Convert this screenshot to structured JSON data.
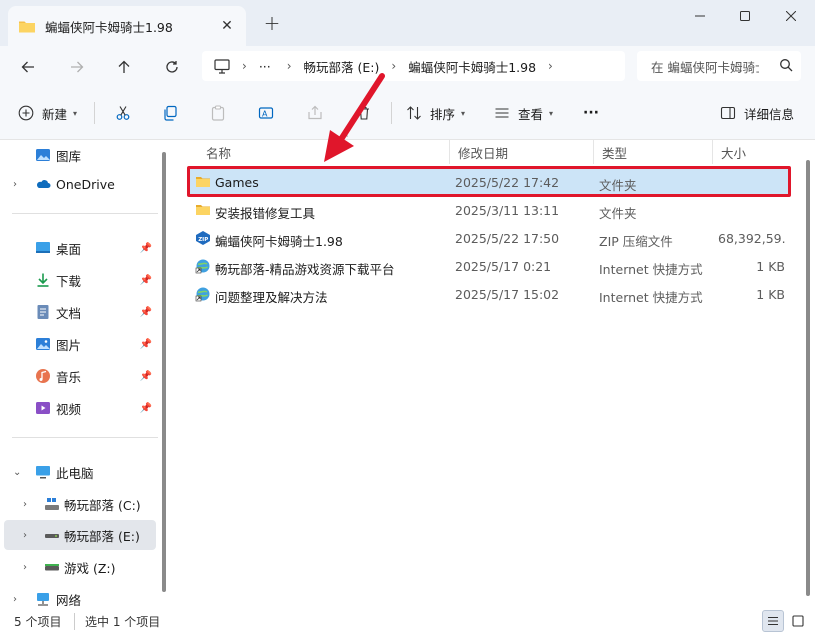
{
  "window": {
    "tab_title": "蝙蝠侠阿卡姆骑士1.98",
    "tab_close": "✕",
    "new_tab": "+"
  },
  "address": {
    "ellipsis": "···",
    "breadcrumbs": [
      "畅玩部落 (E:)",
      "蝙蝠侠阿卡姆骑士1.98"
    ],
    "search_placeholder": "在 蝙蝠侠阿卡姆骑士1.98 中搜索"
  },
  "toolbar": {
    "new_label": "新建",
    "sort_label": "排序",
    "view_label": "查看",
    "more_label": "···",
    "details_label": "详细信息"
  },
  "sidebar": {
    "items": [
      {
        "label": "图库",
        "icon": "gallery-icon"
      },
      {
        "label": "OneDrive",
        "icon": "onedrive-icon"
      },
      {
        "label": "桌面",
        "icon": "desktop-icon"
      },
      {
        "label": "下载",
        "icon": "download-icon"
      },
      {
        "label": "文档",
        "icon": "document-icon"
      },
      {
        "label": "图片",
        "icon": "pictures-icon"
      },
      {
        "label": "音乐",
        "icon": "music-icon"
      },
      {
        "label": "视频",
        "icon": "video-icon"
      },
      {
        "label": "此电脑",
        "icon": "this-pc-icon"
      },
      {
        "label": "畅玩部落 (C:)",
        "icon": "drive-c-icon"
      },
      {
        "label": "畅玩部落 (E:)",
        "icon": "drive-e-icon"
      },
      {
        "label": "游戏 (Z:)",
        "icon": "drive-z-icon"
      },
      {
        "label": "网络",
        "icon": "network-icon"
      }
    ]
  },
  "columns": {
    "name": "名称",
    "date": "修改日期",
    "type": "类型",
    "size": "大小"
  },
  "files": [
    {
      "name": "Games",
      "date": "2025/5/22 17:42",
      "type": "文件夹",
      "size": "",
      "icon": "folder-icon"
    },
    {
      "name": "安装报错修复工具",
      "date": "2025/3/11 13:11",
      "type": "文件夹",
      "size": "",
      "icon": "folder-icon"
    },
    {
      "name": "蝙蝠侠阿卡姆骑士1.98",
      "date": "2025/5/22 17:50",
      "type": "ZIP 压缩文件",
      "size": "68,392,59...",
      "icon": "zip-icon"
    },
    {
      "name": "畅玩部落-精品游戏资源下载平台",
      "date": "2025/5/17 0:21",
      "type": "Internet 快捷方式",
      "size": "1 KB",
      "icon": "internet-shortcut-icon"
    },
    {
      "name": "问题整理及解决方法",
      "date": "2025/5/17 15:02",
      "type": "Internet 快捷方式",
      "size": "1 KB",
      "icon": "internet-shortcut-icon"
    }
  ],
  "status": {
    "item_count": "5 个项目",
    "selection": "选中 1 个项目"
  },
  "colors": {
    "accent": "#0067c0",
    "highlight_border": "#e0162b",
    "folder": "#f5c04a"
  }
}
